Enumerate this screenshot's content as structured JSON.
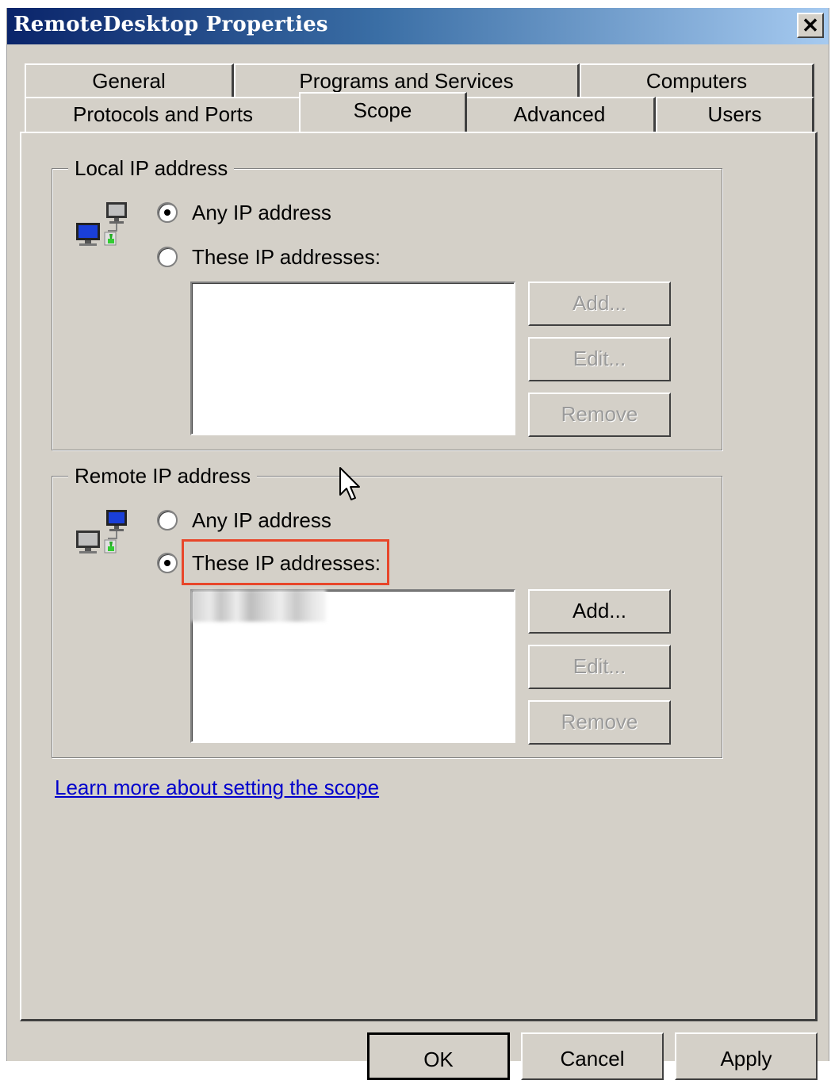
{
  "window": {
    "title": "RemoteDesktop Properties",
    "close_glyph": "✕"
  },
  "tabs": {
    "row1": [
      "General",
      "Programs and Services",
      "Computers"
    ],
    "row2": [
      "Protocols and Ports",
      "Scope",
      "Advanced",
      "Users"
    ],
    "active": "Scope"
  },
  "local": {
    "legend": "Local IP address",
    "any_label": "Any IP address",
    "these_label": "These IP addresses:",
    "selected": "any",
    "buttons": {
      "add": "Add...",
      "edit": "Edit...",
      "remove": "Remove"
    },
    "icon": "network-computers-icon"
  },
  "remote": {
    "legend": "Remote IP address",
    "any_label": "Any IP address",
    "these_label": "These IP addresses:",
    "selected": "these",
    "buttons": {
      "add": "Add...",
      "edit": "Edit...",
      "remove": "Remove"
    },
    "icon": "network-computers-icon",
    "highlight_color": "#e8462a"
  },
  "link": {
    "text": "Learn more about setting the scope"
  },
  "footer": {
    "ok": "OK",
    "cancel": "Cancel",
    "apply": "Apply"
  },
  "colors": {
    "dialog_bg": "#d4d0c8",
    "title_start": "#0a246a",
    "title_end": "#a6caf0",
    "link": "#0000cc"
  }
}
